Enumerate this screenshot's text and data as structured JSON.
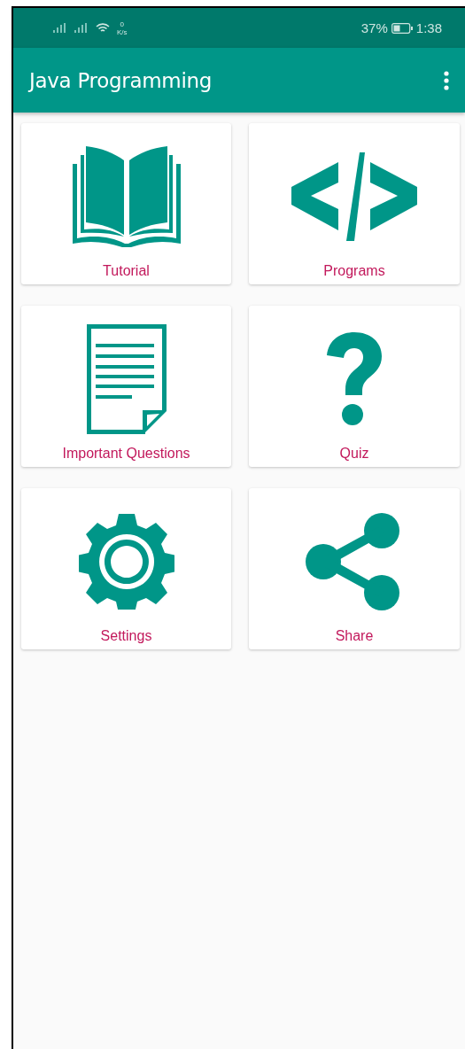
{
  "status_bar": {
    "speed_value": "0",
    "speed_unit": "K/s",
    "battery": "37%",
    "time": "1:38"
  },
  "app_bar": {
    "title": "Java Programming"
  },
  "tiles": [
    {
      "label": "Tutorial"
    },
    {
      "label": "Programs"
    },
    {
      "label": "Important Questions"
    },
    {
      "label": "Quiz"
    },
    {
      "label": "Settings"
    },
    {
      "label": "Share"
    }
  ]
}
